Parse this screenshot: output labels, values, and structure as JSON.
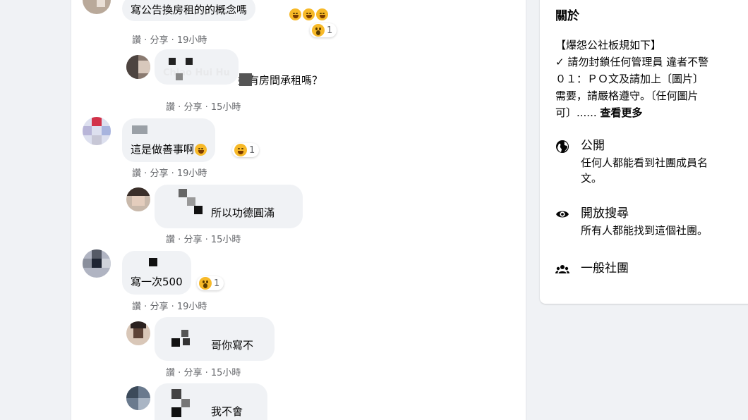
{
  "comments": [
    {
      "author": "",
      "text": "寫公告換房租的的概念嗎",
      "meta": {
        "like": "讚",
        "share": "分享",
        "time": "19小時"
      },
      "reaction_count": "1"
    },
    {
      "author": "Chiao Hui Hu",
      "text": "姐有房間承租嗎？",
      "meta": {
        "like": "讚",
        "share": "分享",
        "time": "15小時"
      }
    },
    {
      "author": "",
      "text": "這是做善事啊",
      "meta": {
        "like": "讚",
        "share": "分享",
        "time": "19小時"
      },
      "reaction_count": "1"
    },
    {
      "author": "",
      "text": "所以功德圓滿",
      "meta": {
        "like": "讚",
        "share": "分享",
        "time": "15小時"
      }
    },
    {
      "author": "",
      "text": "寫一次500",
      "meta": {
        "like": "讚",
        "share": "分享",
        "time": "19小時"
      },
      "reaction_count": "1"
    },
    {
      "author": "",
      "text": "哥你寫不",
      "meta": {
        "like": "讚",
        "share": "分享",
        "time": "15小時"
      }
    },
    {
      "author": "",
      "text": "我不會"
    }
  ],
  "meta_separator": "·",
  "about": {
    "title": "關於",
    "rules_text": "【爆怨公社板規如下】\n✓ 請勿封鎖任何管理員 違者不警\n０１：ＰＯ文及請加上〔圖片〕\n需要，請嚴格遵守。〔任何圖片\n可〕......",
    "see_more": "查看更多",
    "items": [
      {
        "icon": "globe-icon",
        "title": "公開",
        "desc": "任何人都能看到社團成員名\n文。"
      },
      {
        "icon": "eye-icon",
        "title": "開放搜尋",
        "desc": "所有人都能找到這個社團。"
      },
      {
        "icon": "people-icon",
        "title": "一般社團",
        "desc": ""
      }
    ]
  },
  "colors": {
    "accent_text": "#65676b",
    "bubble": "#f0f2f5",
    "background": "#f0f2f5",
    "emoji": "#f7b928"
  }
}
